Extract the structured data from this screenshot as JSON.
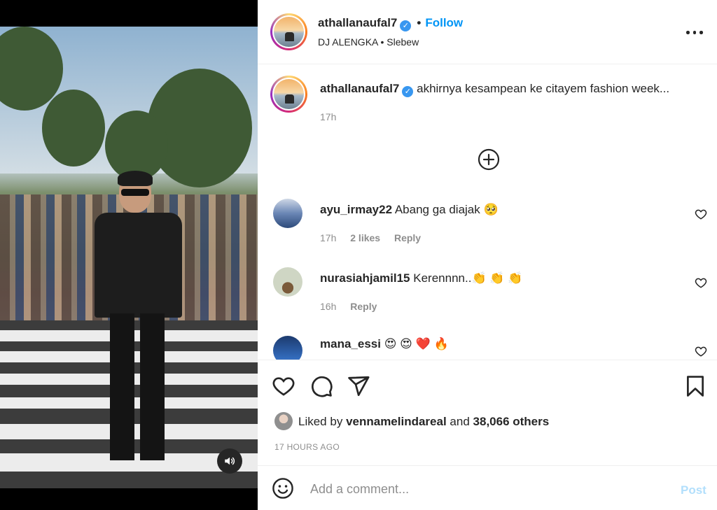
{
  "post": {
    "username": "athallanaufal7",
    "verified_icon": "verified-badge-icon",
    "follow_label": "Follow",
    "subtitle": "DJ ALENGKA • Slebew",
    "more_icon": "more-options-icon"
  },
  "caption": {
    "username": "athallanaufal7",
    "text": "akhirnya kesampean ke citayem fashion week...",
    "time": "17h"
  },
  "load_more_icon": "plus-circle-icon",
  "comments": [
    {
      "username": "ayu_irmay22",
      "text": "Abang ga diajak 🥺",
      "time": "17h",
      "likes": "2 likes",
      "reply": "Reply"
    },
    {
      "username": "nurasiahjamil15",
      "text": "Kerennnn..",
      "emojis": [
        "👏",
        "👏",
        "👏"
      ],
      "time": "16h",
      "reply": "Reply"
    },
    {
      "username": "mana_essi",
      "text": "",
      "emojis": [
        "😍",
        "😍",
        "❤️",
        "🔥"
      ]
    }
  ],
  "actions": {
    "like_icon": "heart-icon",
    "comment_icon": "comment-icon",
    "share_icon": "share-icon",
    "save_icon": "bookmark-icon"
  },
  "likes": {
    "prefix": "Liked by",
    "user": "vennamelindareal",
    "connector": "and",
    "others": "38,066 others"
  },
  "timeago": "17 HOURS AGO",
  "composer": {
    "placeholder": "Add a comment...",
    "post_label": "Post",
    "emoji_icon": "smiley-icon"
  },
  "media": {
    "mute_icon": "speaker-icon"
  },
  "colors": {
    "link_blue": "#0095f6",
    "post_disabled": "#b2dffc",
    "muted_text": "#8e8e8e"
  }
}
